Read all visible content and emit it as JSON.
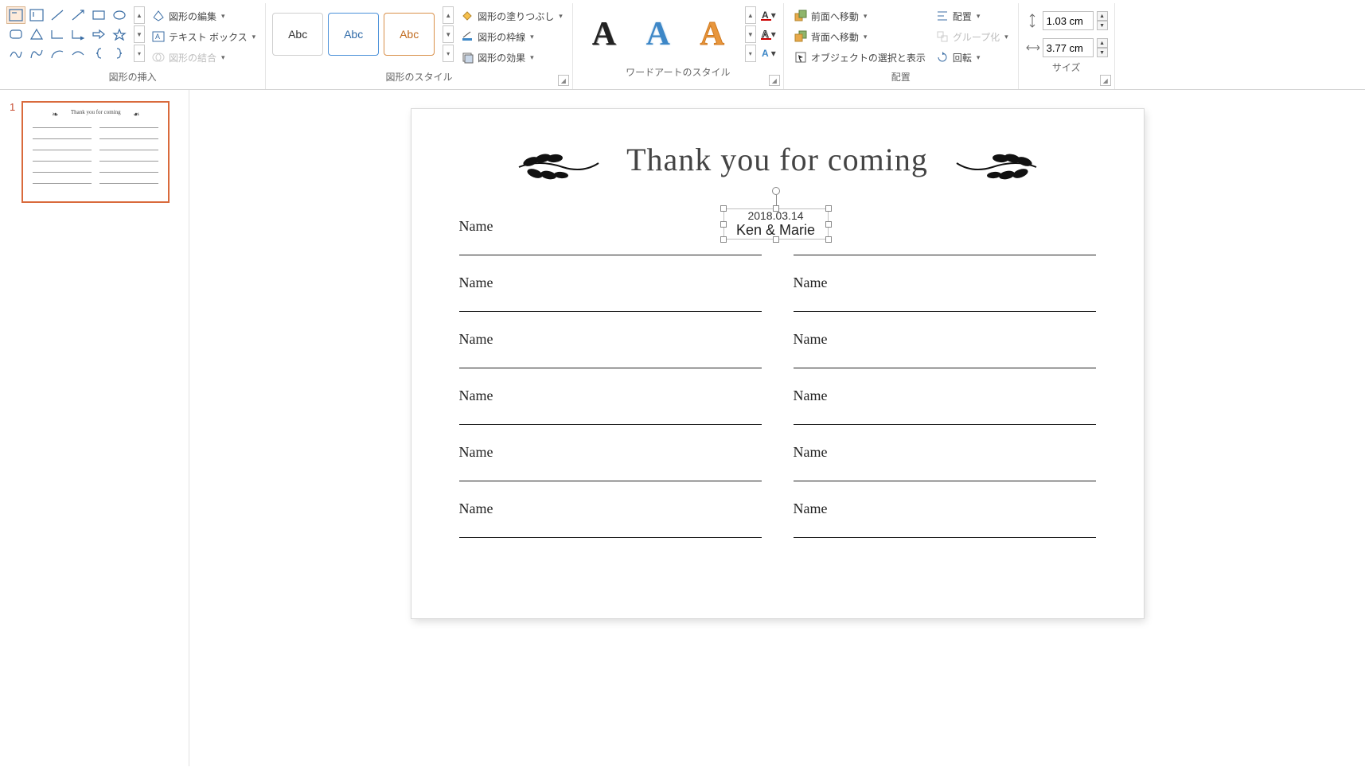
{
  "ribbon": {
    "groups": {
      "insert_shapes": {
        "label": "図形の挿入",
        "edit_shape": "図形の編集",
        "text_box": "テキスト ボックス",
        "merge_shapes": "図形の結合"
      },
      "shape_styles": {
        "label": "図形のスタイル",
        "fill": "図形の塗りつぶし",
        "outline": "図形の枠線",
        "effects": "図形の効果",
        "sample": "Abc"
      },
      "wordart": {
        "label": "ワードアートのスタイル",
        "sample": "A"
      },
      "arrange": {
        "label": "配置",
        "bring_forward": "前面へ移動",
        "send_backward": "背面へ移動",
        "selection_pane": "オブジェクトの選択と表示",
        "align": "配置",
        "group": "グループ化",
        "rotate": "回転"
      },
      "size": {
        "label": "サイズ",
        "height": "1.03 cm",
        "width": "3.77 cm"
      }
    }
  },
  "thumbnail": {
    "number": "1"
  },
  "slide": {
    "title": "Thank you for coming",
    "date": "2018.03.14",
    "names": "Ken & Marie",
    "name_label": "Name",
    "rows": 6
  }
}
